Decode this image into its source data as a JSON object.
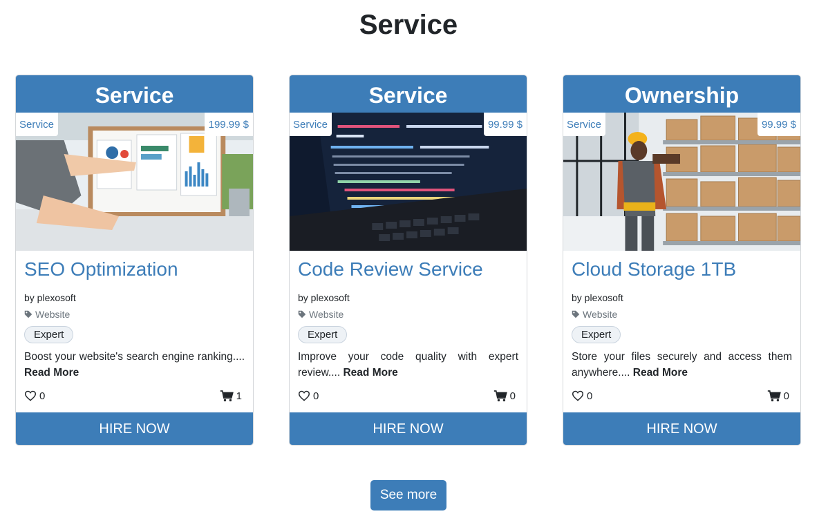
{
  "section": {
    "title": "Service"
  },
  "cards": [
    {
      "header": "Service",
      "category_badge": "Service",
      "price": "199.99 $",
      "title": "SEO Optimization",
      "author": "by plexosoft",
      "tag": "Website",
      "level": "Expert",
      "description": "Boost your website's search engine ranking....",
      "read_more": "Read More",
      "likes": "0",
      "cart": "1",
      "button": "HIRE NOW",
      "image_icon": "analytics-charts-photo"
    },
    {
      "header": "Service",
      "category_badge": "Service",
      "price": "99.99 $",
      "title": "Code Review Service",
      "author": "by plexosoft",
      "tag": "Website",
      "level": "Expert",
      "description": "Improve your code quality with expert review....",
      "read_more": "Read More",
      "likes": "0",
      "cart": "0",
      "button": "HIRE NOW",
      "image_icon": "code-laptop-photo"
    },
    {
      "header": "Ownership",
      "category_badge": "Service",
      "price": "99.99 $",
      "title": "Cloud Storage 1TB",
      "author": "by plexosoft",
      "tag": "Website",
      "level": "Expert",
      "description": "Store your files securely and access them anywhere....",
      "read_more": "Read More",
      "likes": "0",
      "cart": "0",
      "button": "HIRE NOW",
      "image_icon": "warehouse-worker-photo"
    }
  ],
  "see_more": "See more",
  "colors": {
    "primary": "#3d7db8",
    "text": "#212529",
    "muted": "#6c757d"
  }
}
